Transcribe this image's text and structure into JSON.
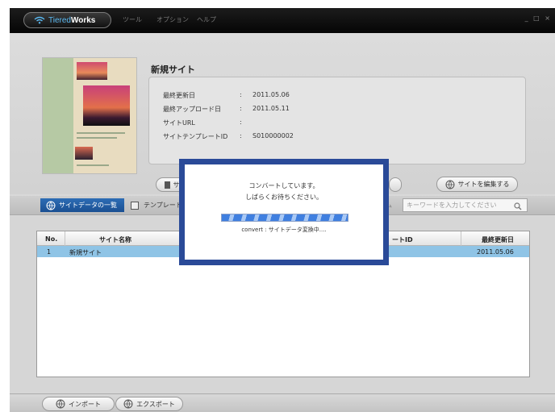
{
  "app": {
    "logo_a": "Tiered",
    "logo_b": "Works"
  },
  "menu": {
    "tools": "ツール",
    "options": "オプション",
    "help": "ヘルプ"
  },
  "window_controls": "_ □ ×",
  "site": {
    "title": "新規サイト",
    "fields": [
      {
        "label": "最終更新日",
        "sep": ":",
        "value": "2011.05.06"
      },
      {
        "label": "最終アップロード日",
        "sep": ":",
        "value": "2011.05.11"
      },
      {
        "label": "サイトURL",
        "sep": ":",
        "value": ""
      },
      {
        "label": "サイトテンプレートID",
        "sep": ":",
        "value": "S010000002"
      }
    ],
    "edit_button": "サイトを編集する",
    "left_button_partial": "サ"
  },
  "tabs": {
    "site_list": "サイトデータの一覧",
    "template": "テンプレート"
  },
  "search": {
    "placeholder": "キーワードを入力してください",
    "partial_label": "ム"
  },
  "table": {
    "headers": {
      "no": "No.",
      "name": "サイト名称",
      "template_id": "ートID",
      "updated": "最終更新日"
    },
    "rows": [
      {
        "no": "1",
        "name": "新規サイト",
        "updated": "2011.05.06"
      }
    ]
  },
  "bottom": {
    "import": "インポート",
    "export": "エクスポート"
  },
  "modal": {
    "line1": "コンバートしています。",
    "line2": "しばらくお待ちください。",
    "status": "convert : サイトデータ変換中....",
    "progress": 1.0
  },
  "colors": {
    "accent": "#1f5aa6",
    "selection": "#8fc4e6",
    "modal_border": "#2a4a98"
  }
}
